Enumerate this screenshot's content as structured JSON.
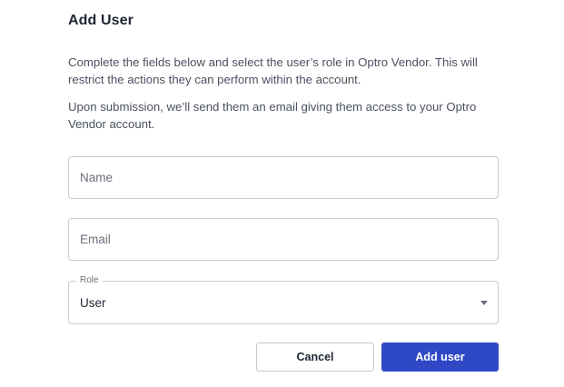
{
  "dialog": {
    "title": "Add User",
    "description_1": "Complete the fields below and select the user’s role in Optro Vendor. This will restrict the actions they can perform within the account.",
    "description_2": "Upon submission, we’ll send them an email giving them access to your Optro Vendor account."
  },
  "form": {
    "name": {
      "placeholder": "Name",
      "value": ""
    },
    "email": {
      "placeholder": "Email",
      "value": ""
    },
    "role": {
      "label": "Role",
      "selected": "User",
      "icon": "caret-down-icon"
    }
  },
  "actions": {
    "cancel_label": "Cancel",
    "submit_label": "Add user"
  },
  "colors": {
    "primary": "#2f49c6",
    "title_text": "#1f2533",
    "body_text": "#4b5160",
    "border": "#c6c9cf"
  }
}
